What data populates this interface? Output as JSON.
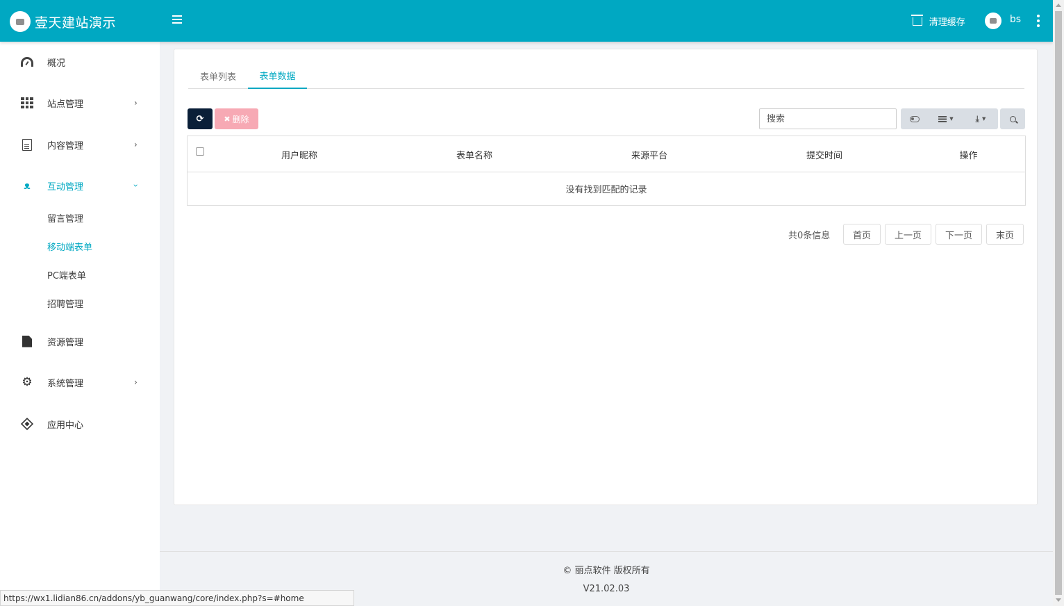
{
  "header": {
    "brand_title": "壹天建站演示",
    "clear_cache": "清理缓存",
    "user_name": "bs"
  },
  "sidebar": {
    "items": [
      {
        "label": "概况",
        "icon": "dashboard-icon"
      },
      {
        "label": "站点管理",
        "icon": "grid-icon"
      },
      {
        "label": "内容管理",
        "icon": "document-icon"
      },
      {
        "label": "互动管理",
        "icon": "handshake-icon"
      },
      {
        "label": "资源管理",
        "icon": "file-icon"
      },
      {
        "label": "系统管理",
        "icon": "gear-icon"
      },
      {
        "label": "应用中心",
        "icon": "cube-icon"
      }
    ],
    "sub_items": [
      {
        "label": "留言管理"
      },
      {
        "label": "移动端表单"
      },
      {
        "label": "PC端表单"
      },
      {
        "label": "招聘管理"
      }
    ]
  },
  "tabs": [
    {
      "label": "表单列表"
    },
    {
      "label": "表单数据"
    }
  ],
  "toolbar": {
    "delete_label": "删除",
    "search_placeholder": "搜索"
  },
  "table": {
    "columns": [
      "用户昵称",
      "表单名称",
      "来源平台",
      "提交时间",
      "操作"
    ],
    "empty_text": "没有找到匹配的记录"
  },
  "pagination": {
    "total_text": "共0条信息",
    "first": "首页",
    "prev": "上一页",
    "next": "下一页",
    "last": "末页"
  },
  "footer": {
    "copyright": "© 丽点软件 版权所有",
    "version": "V21.02.03"
  },
  "status_url": "https://wx1.lidian86.cn/addons/yb_guanwang/core/index.php?s=#home",
  "colors": {
    "primary": "#00a8c2",
    "dark_button": "#0a1f38",
    "delete_button": "#f7a9b4"
  }
}
